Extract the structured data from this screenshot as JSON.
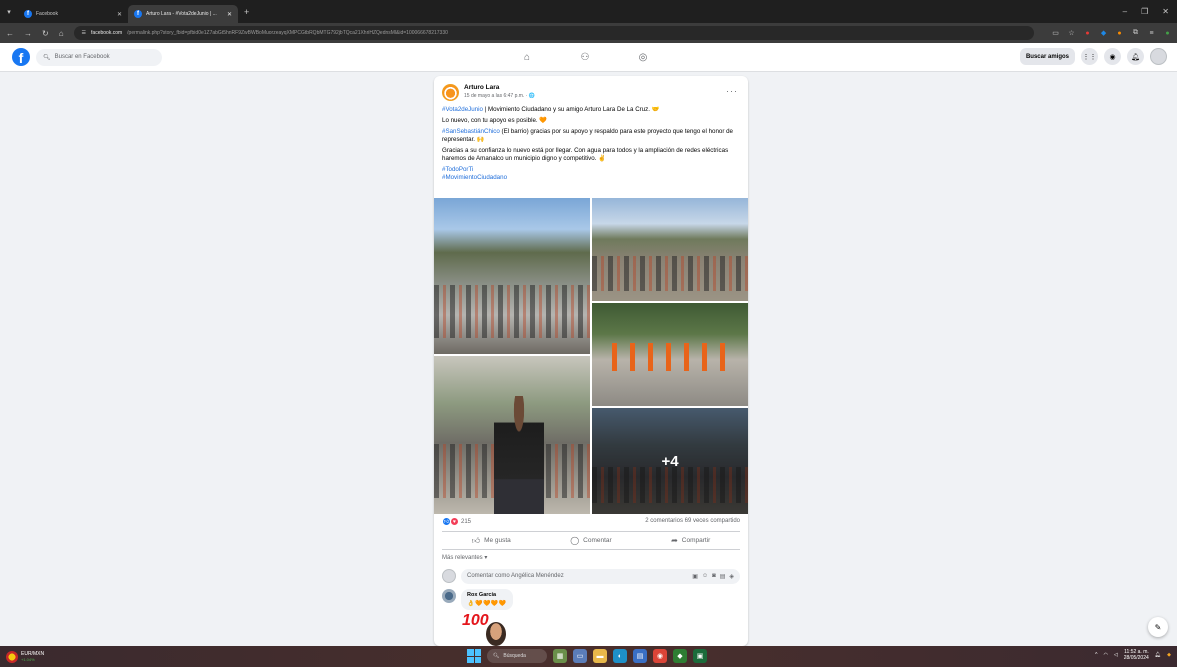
{
  "browser": {
    "tabs": [
      {
        "title": "Facebook",
        "active": false
      },
      {
        "title": "Arturo Lara - #Vota2deJunio | ...",
        "active": true
      }
    ],
    "new_tab": "+",
    "url_domain": "facebook.com",
    "url_path": "/permalink.php?story_fbid=pfbid0e1Z7abGt5hnRF9ZwBWBoMuorzeayqXMPCGtbRQbMTG792jbTQca21XhriHZQednsMl&id=100066678217330"
  },
  "facebook": {
    "search_placeholder": "Buscar en Facebook",
    "find_friends_label": "Buscar amigos",
    "brand_color": "#1877f2"
  },
  "post": {
    "author": "Arturo Lara",
    "meta": "15 de mayo a las 6:47 p.m. · 🌐",
    "paragraphs": {
      "p1_tag": "#Vota2deJunio",
      "p1_text": " | Movimiento Ciudadano y su amigo Arturo Lara De La Cruz. 🤝",
      "p2_text": "Lo nuevo, con tu apoyo es posible. 🧡",
      "p3_tag": "#SanSebastiánChico",
      "p3_text": " (El barrio) gracias por su apoyo y respaldo para este proyecto que tengo el honor de representar. 🙌",
      "p4_text": "Gracias a su confianza lo nuevo está por llegar. Con agua para todos y la ampliación de redes eléctricas haremos de Amanalco un municipio digno y competitivo. ✌️",
      "tag_a": "#TodoPorTi",
      "tag_b": "#MovimientoCiudadano"
    },
    "more_photos": "+4",
    "reaction_count": "215",
    "stats": "2 comentarios  69 veces compartido",
    "actions": {
      "like": "Me gusta",
      "comment": "Comentar",
      "share": "Compartir"
    },
    "sort_label": "Más relevantes ▾",
    "comment_placeholder": "Comentar como Angélica Menéndez",
    "comments": [
      {
        "name": "Rox García",
        "body": "👌🧡🧡🧡🧡"
      }
    ],
    "sticker_text": "100"
  },
  "taskbar": {
    "ticker_name": "EUR/MXN",
    "ticker_change": "+1.04%",
    "search_label": "Búsqueda",
    "time": "11:52 a. m.",
    "date": "28/05/2024"
  }
}
